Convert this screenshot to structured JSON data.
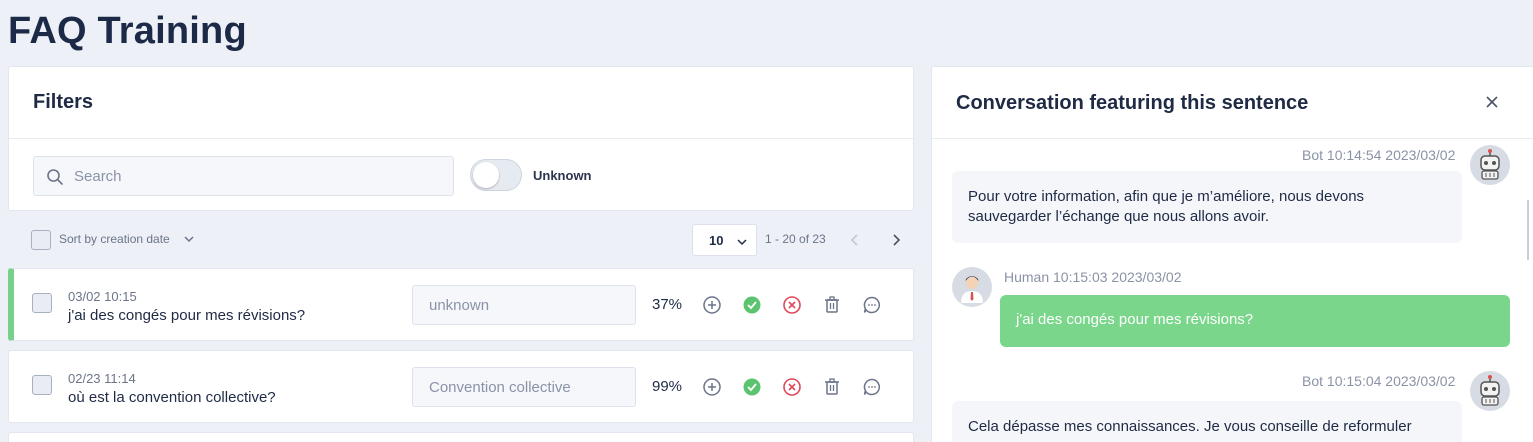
{
  "page": {
    "title": "FAQ Training"
  },
  "filters": {
    "title": "Filters",
    "search_placeholder": "Search",
    "toggle_label": "Unknown",
    "toggle_on": false
  },
  "toolbar": {
    "sort_label": "Sort by creation date",
    "per_page": "10",
    "range_text": "1 - 20 of 23"
  },
  "rows": [
    {
      "date": "03/02 10:15",
      "sentence": "j'ai des congés pour mes révisions?",
      "intent_placeholder": "unknown",
      "confidence": "37%",
      "selected": true
    },
    {
      "date": "02/23 11:14",
      "sentence": "où est la convention collective?",
      "intent_placeholder": "Convention collective",
      "confidence": "99%",
      "selected": false
    }
  ],
  "conversation": {
    "title": "Conversation featuring this sentence",
    "messages": [
      {
        "author": "Bot",
        "meta": "Bot 10:14:54 2023/03/02",
        "text": "Pour votre information, afin que je m’améliore, nous devons sauvegarder l’échange que nous allons avoir."
      },
      {
        "author": "Human",
        "meta": "Human 10:15:03 2023/03/02",
        "text": "j'ai des congés pour mes révisions?"
      },
      {
        "author": "Bot",
        "meta": "Bot 10:15:04 2023/03/02",
        "text": "Cela dépasse mes connaissances. Je vous conseille de reformuler"
      }
    ]
  },
  "colors": {
    "accent_green": "#79d68b",
    "title_navy": "#1c2a48",
    "validate_green": "#5cc46e",
    "reject_red": "#e0485a",
    "icon_gray": "#6b7489"
  },
  "icons": [
    "search-icon",
    "chevron-down-icon",
    "chevron-left-icon",
    "chevron-right-icon",
    "plus-circle-icon",
    "check-circle-icon",
    "x-circle-icon",
    "trash-icon",
    "chat-bubble-icon",
    "close-icon",
    "robot-icon",
    "user-icon"
  ]
}
